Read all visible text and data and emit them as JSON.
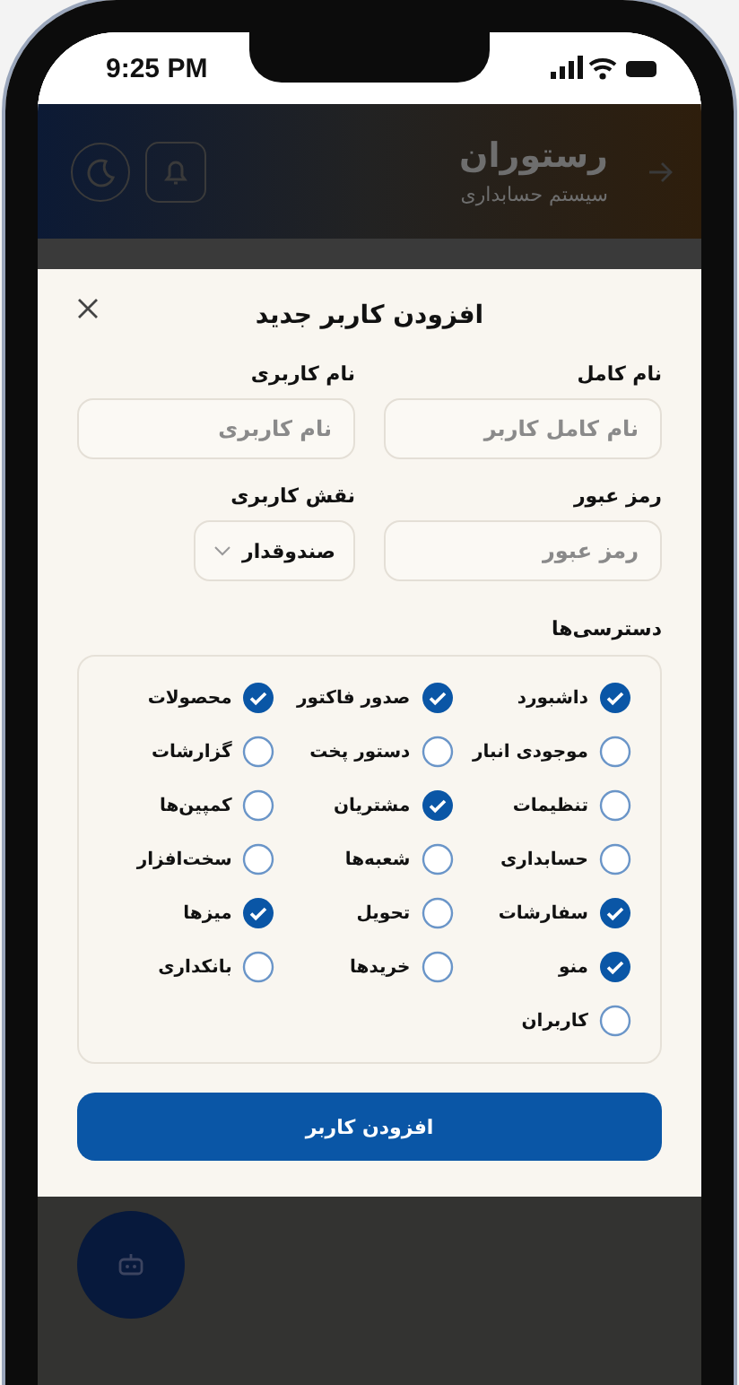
{
  "status_bar": {
    "time": "9:25 PM"
  },
  "header": {
    "title": "رستوران",
    "subtitle": "سیستم حسابداری"
  },
  "dialog": {
    "title": "افزودن کاربر جدید",
    "fields": [
      {
        "kind": "text",
        "label": "نام کامل",
        "placeholder": "نام کامل کاربر"
      },
      {
        "kind": "text",
        "label": "نام کاربری",
        "placeholder": "نام کاربری"
      },
      {
        "kind": "text",
        "label": "رمز عبور",
        "placeholder": "رمز عبور"
      },
      {
        "kind": "select",
        "label": "نقش کاربری",
        "value": "صندوقدار"
      }
    ],
    "permissions_label": "دسترسی‌ها",
    "permissions": [
      {
        "label": "داشبورد",
        "checked": true
      },
      {
        "label": "صدور فاکتور",
        "checked": true
      },
      {
        "label": "محصولات",
        "checked": true
      },
      {
        "label": "موجودی انبار",
        "checked": false
      },
      {
        "label": "دستور پخت",
        "checked": false
      },
      {
        "label": "گزارشات",
        "checked": false
      },
      {
        "label": "تنظیمات",
        "checked": false
      },
      {
        "label": "مشتریان",
        "checked": true
      },
      {
        "label": "کمپین‌ها",
        "checked": false
      },
      {
        "label": "حسابداری",
        "checked": false
      },
      {
        "label": "شعبه‌ها",
        "checked": false
      },
      {
        "label": "سخت‌افزار",
        "checked": false
      },
      {
        "label": "سفارشات",
        "checked": true
      },
      {
        "label": "تحویل",
        "checked": false
      },
      {
        "label": "میزها",
        "checked": true
      },
      {
        "label": "منو",
        "checked": true
      },
      {
        "label": "خریدها",
        "checked": false
      },
      {
        "label": "بانکداری",
        "checked": false
      },
      {
        "label": "کاربران",
        "checked": false
      }
    ],
    "submit": "افزودن کاربر"
  }
}
